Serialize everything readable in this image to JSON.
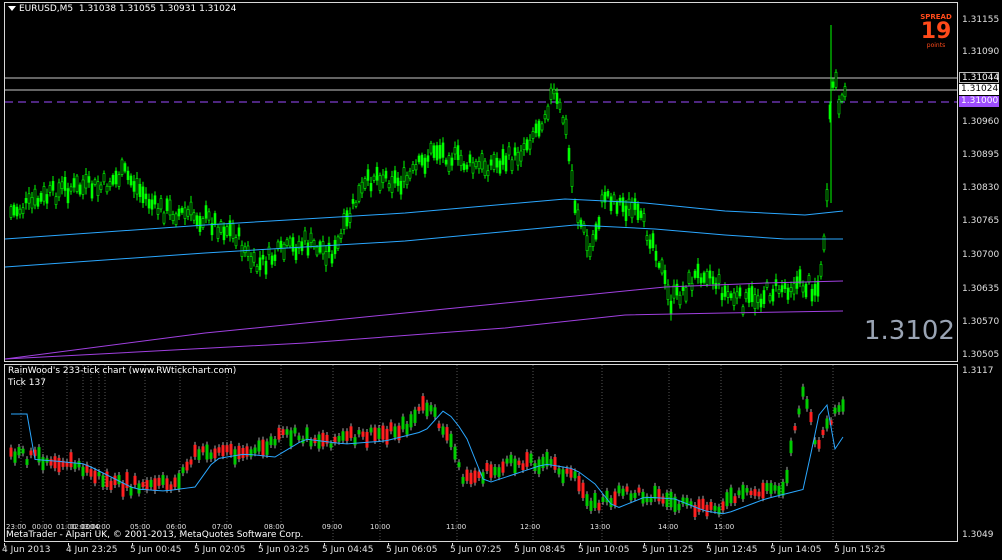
{
  "header": {
    "symbol": "EURUSD,M5",
    "ohlc": "1.31038 1.31055 1.30931 1.31024"
  },
  "spread": {
    "label": "SPREAD",
    "value": "19",
    "unit": "points"
  },
  "big_price": "1.3102",
  "price_axis": [
    "1.31155",
    "1.31090",
    "1.30960",
    "1.30895",
    "1.30830",
    "1.30765",
    "1.30700",
    "1.30635",
    "1.30570",
    "1.30505"
  ],
  "price_tags": {
    "upper": "1.31044",
    "current": "1.31024",
    "level": "1.31000"
  },
  "sub_axis": {
    "top": "1.3117",
    "bottom": "1.3049"
  },
  "indicator": {
    "title": "RainWood's 233-tick chart  (www.RWtickchart.com)",
    "tick": "Tick 137"
  },
  "hour_labels": [
    "23:00",
    "00:00",
    "01:00",
    "02:00",
    "03:00",
    "04:00",
    "05:00",
    "06:00",
    "07:00",
    "08:00",
    "09:00",
    "10:00",
    "11:00",
    "12:00",
    "13:00",
    "14:00",
    "15:00"
  ],
  "copyright": "MetaTrader - Alpari UK, © 2001-2013, MetaQuotes Software Corp.",
  "time_axis": [
    "4 Jun 2013",
    "4 Jun 23:25",
    "5 Jun 00:45",
    "5 Jun 02:05",
    "5 Jun 03:25",
    "5 Jun 04:45",
    "5 Jun 06:05",
    "5 Jun 07:25",
    "5 Jun 08:45",
    "5 Jun 10:05",
    "5 Jun 11:25",
    "5 Jun 12:45",
    "5 Jun 14:05",
    "5 Jun 15:25"
  ],
  "colors": {
    "candle": "#00ff00",
    "ma_fast": "#2aa7ff",
    "ma_slow": "#a040e0",
    "level_line": "#9d4dff",
    "spread": "#ff4a1a",
    "bull": "#00cc00",
    "bear": "#ff2020"
  }
}
